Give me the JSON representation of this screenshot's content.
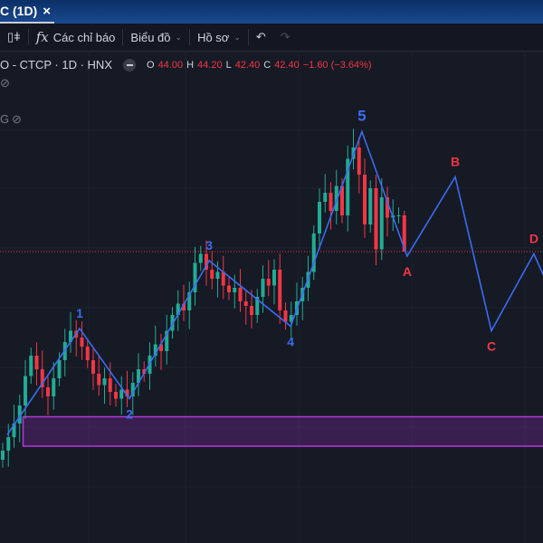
{
  "tab": {
    "label": "C (1D)",
    "close": "×"
  },
  "toolbar": {
    "indicators": "Các chỉ báo",
    "chart": "Biểu đồ",
    "profile": "Hồ sơ"
  },
  "legend": {
    "symbol": "O - CTCP · 1D · HNX",
    "o_label": "O",
    "o": "44.00",
    "h_label": "H",
    "h": "44.20",
    "l_label": "L",
    "l": "42.40",
    "c_label": "C",
    "c": "42.40",
    "change": "−1.60 (−3.64%)",
    "partial": "G"
  },
  "colors": {
    "up": "#22ab94",
    "down": "#f23645",
    "wave": "#3b6cf0",
    "bg": "#161a25",
    "zone": "#b03ad6"
  },
  "chart_data": {
    "type": "candlestick",
    "last_price": 42.4,
    "closes": [
      33.6,
      34.2,
      34.8,
      35.6,
      36.9,
      37.8,
      37.2,
      36.4,
      36.0,
      36.8,
      37.6,
      38.4,
      38.9,
      38.6,
      38.2,
      37.6,
      37.0,
      36.5,
      36.8,
      36.2,
      35.9,
      36.3,
      36.0,
      36.6,
      37.2,
      37.0,
      37.8,
      38.3,
      38.0,
      38.9,
      39.6,
      40.1,
      39.8,
      40.6,
      41.9,
      42.3,
      41.6,
      41.2,
      41.5,
      40.9,
      40.6,
      40.8,
      40.2,
      40.0,
      39.6,
      40.4,
      41.2,
      40.9,
      41.6,
      39.8,
      39.3,
      39.6,
      40.2,
      40.8,
      41.5,
      43.2,
      44.6,
      45.0,
      44.2,
      45.3,
      44.0,
      46.5,
      47.0,
      45.8,
      43.6,
      45.2,
      42.5,
      44.8,
      43.9,
      44.0,
      44.0,
      42.4
    ],
    "first_open": 33.2,
    "last_bar": {
      "o": 44.0,
      "h": 44.2,
      "l": 42.4,
      "c": 42.4
    },
    "waves": [
      {
        "label": "",
        "bar": 0.8,
        "price": 34.3,
        "color": "blue"
      },
      {
        "label": "1",
        "bar": 13.6,
        "price": 39.0,
        "color": "blue"
      },
      {
        "label": "2",
        "bar": 22.4,
        "price": 35.9,
        "color": "blue"
      },
      {
        "label": "3",
        "bar": 36.5,
        "price": 42.0,
        "color": "blue"
      },
      {
        "label": "4",
        "bar": 50.9,
        "price": 39.1,
        "color": "blue"
      },
      {
        "label": "5",
        "bar": 63.5,
        "price": 47.7,
        "color": "blue"
      },
      {
        "label": "A",
        "bar": 71.5,
        "price": 42.2,
        "color": "red"
      },
      {
        "label": "B",
        "bar": 80,
        "price": 45.7,
        "color": "red"
      },
      {
        "label": "C",
        "bar": 86.4,
        "price": 38.9,
        "color": "red"
      },
      {
        "label": "D",
        "bar": 93.9,
        "price": 42.3,
        "color": "red"
      },
      {
        "label": "",
        "bar": 96.8,
        "price": 40.7,
        "color": "blue"
      }
    ],
    "zone": {
      "from_bar": 3.6,
      "top": 35.1,
      "bottom": 33.8
    }
  }
}
